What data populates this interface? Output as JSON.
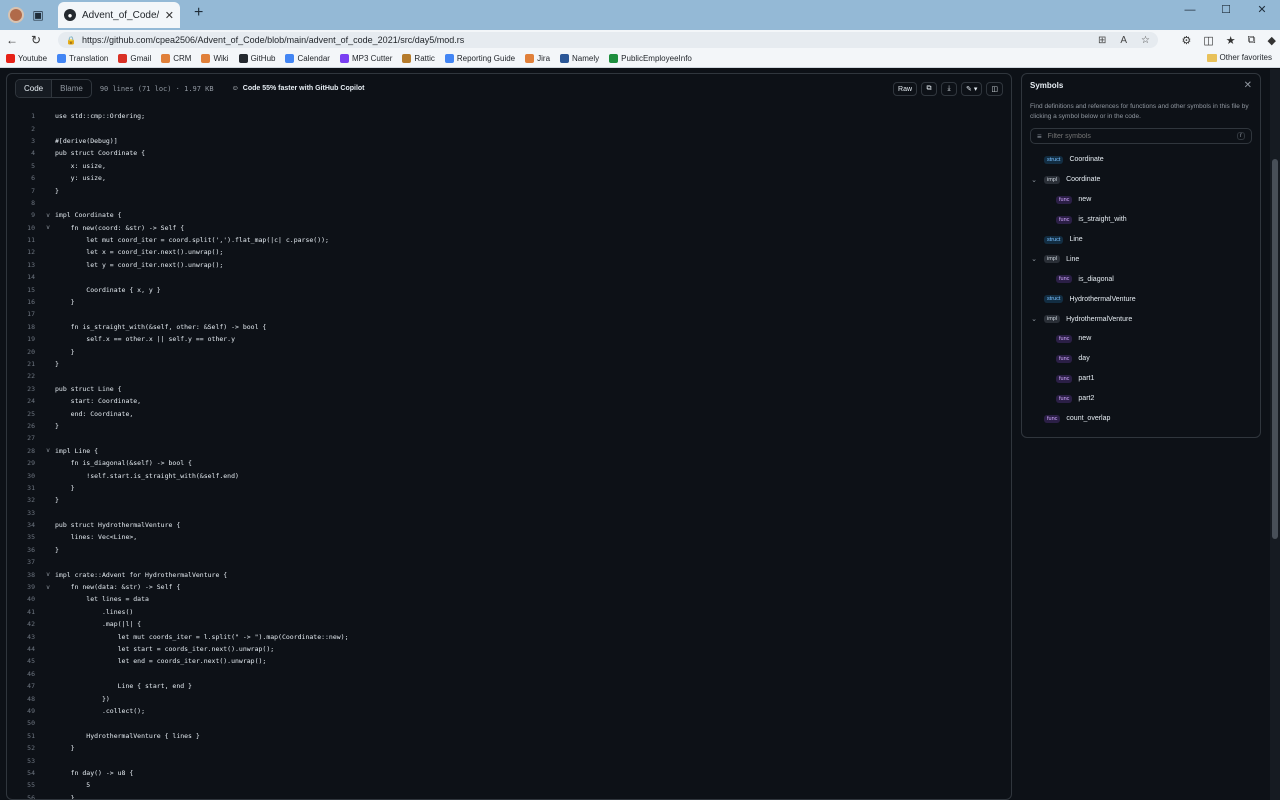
{
  "browser": {
    "tab_title": "Advent_of_Code/advent_of_code",
    "url": "https://github.com/cpea2506/Advent_of_Code/blob/main/advent_of_code_2021/src/day5/mod.rs",
    "bookmarks": [
      {
        "label": "Youtube",
        "color": "#e62117"
      },
      {
        "label": "Translation",
        "color": "#4285f4"
      },
      {
        "label": "Gmail",
        "color": "#d93025"
      },
      {
        "label": "CRM",
        "color": "#e0803a"
      },
      {
        "label": "Wiki",
        "color": "#e0803a"
      },
      {
        "label": "GitHub",
        "color": "#24292f"
      },
      {
        "label": "Calendar",
        "color": "#4285f4"
      },
      {
        "label": "MP3 Cutter",
        "color": "#7a3ff2"
      },
      {
        "label": "Rattic",
        "color": "#b57b2c"
      },
      {
        "label": "Reporting Guide",
        "color": "#4285f4"
      },
      {
        "label": "Jira",
        "color": "#e0803a"
      },
      {
        "label": "Namely",
        "color": "#2b5797"
      },
      {
        "label": "PublicEmployeeInfo",
        "color": "#1e8e3e"
      }
    ],
    "other_favorites": "Other favorites"
  },
  "code_header": {
    "code_tab": "Code",
    "blame_tab": "Blame",
    "file_info": "90 lines (71 loc) · 1.97 KB",
    "copilot": "Code 55% faster with GitHub Copilot",
    "raw": "Raw"
  },
  "code_lines": [
    {
      "n": "1",
      "fold": "",
      "text": "use std::cmp::Ordering;"
    },
    {
      "n": "2",
      "fold": "",
      "text": ""
    },
    {
      "n": "3",
      "fold": "",
      "text": "#[derive(Debug)]"
    },
    {
      "n": "4",
      "fold": "",
      "text": "pub struct Coordinate {"
    },
    {
      "n": "5",
      "fold": "",
      "text": "    x: usize,"
    },
    {
      "n": "6",
      "fold": "",
      "text": "    y: usize,"
    },
    {
      "n": "7",
      "fold": "",
      "text": "}"
    },
    {
      "n": "8",
      "fold": "",
      "text": ""
    },
    {
      "n": "9",
      "fold": "v",
      "text": "impl Coordinate {"
    },
    {
      "n": "10",
      "fold": "v",
      "text": "    fn new(coord: &str) -> Self {"
    },
    {
      "n": "11",
      "fold": "",
      "text": "        let mut coord_iter = coord.split(',').flat_map(|c| c.parse());"
    },
    {
      "n": "12",
      "fold": "",
      "text": "        let x = coord_iter.next().unwrap();"
    },
    {
      "n": "13",
      "fold": "",
      "text": "        let y = coord_iter.next().unwrap();"
    },
    {
      "n": "14",
      "fold": "",
      "text": ""
    },
    {
      "n": "15",
      "fold": "",
      "text": "        Coordinate { x, y }"
    },
    {
      "n": "16",
      "fold": "",
      "text": "    }"
    },
    {
      "n": "17",
      "fold": "",
      "text": ""
    },
    {
      "n": "18",
      "fold": "",
      "text": "    fn is_straight_with(&self, other: &Self) -> bool {"
    },
    {
      "n": "19",
      "fold": "",
      "text": "        self.x == other.x || self.y == other.y"
    },
    {
      "n": "20",
      "fold": "",
      "text": "    }"
    },
    {
      "n": "21",
      "fold": "",
      "text": "}"
    },
    {
      "n": "22",
      "fold": "",
      "text": ""
    },
    {
      "n": "23",
      "fold": "",
      "text": "pub struct Line {"
    },
    {
      "n": "24",
      "fold": "",
      "text": "    start: Coordinate,"
    },
    {
      "n": "25",
      "fold": "",
      "text": "    end: Coordinate,"
    },
    {
      "n": "26",
      "fold": "",
      "text": "}"
    },
    {
      "n": "27",
      "fold": "",
      "text": ""
    },
    {
      "n": "28",
      "fold": "v",
      "text": "impl Line {"
    },
    {
      "n": "29",
      "fold": "",
      "text": "    fn is_diagonal(&self) -> bool {"
    },
    {
      "n": "30",
      "fold": "",
      "text": "        !self.start.is_straight_with(&self.end)"
    },
    {
      "n": "31",
      "fold": "",
      "text": "    }"
    },
    {
      "n": "32",
      "fold": "",
      "text": "}"
    },
    {
      "n": "33",
      "fold": "",
      "text": ""
    },
    {
      "n": "34",
      "fold": "",
      "text": "pub struct HydrothermalVenture {"
    },
    {
      "n": "35",
      "fold": "",
      "text": "    lines: Vec<Line>,"
    },
    {
      "n": "36",
      "fold": "",
      "text": "}"
    },
    {
      "n": "37",
      "fold": "",
      "text": ""
    },
    {
      "n": "38",
      "fold": "v",
      "text": "impl crate::Advent for HydrothermalVenture {"
    },
    {
      "n": "39",
      "fold": "v",
      "text": "    fn new(data: &str) -> Self {"
    },
    {
      "n": "40",
      "fold": "",
      "text": "        let lines = data"
    },
    {
      "n": "41",
      "fold": "",
      "text": "            .lines()"
    },
    {
      "n": "42",
      "fold": "",
      "text": "            .map(|l| {"
    },
    {
      "n": "43",
      "fold": "",
      "text": "                let mut coords_iter = l.split(\" -> \").map(Coordinate::new);"
    },
    {
      "n": "44",
      "fold": "",
      "text": "                let start = coords_iter.next().unwrap();"
    },
    {
      "n": "45",
      "fold": "",
      "text": "                let end = coords_iter.next().unwrap();"
    },
    {
      "n": "46",
      "fold": "",
      "text": ""
    },
    {
      "n": "47",
      "fold": "",
      "text": "                Line { start, end }"
    },
    {
      "n": "48",
      "fold": "",
      "text": "            })"
    },
    {
      "n": "49",
      "fold": "",
      "text": "            .collect();"
    },
    {
      "n": "50",
      "fold": "",
      "text": ""
    },
    {
      "n": "51",
      "fold": "",
      "text": "        HydrothermalVenture { lines }"
    },
    {
      "n": "52",
      "fold": "",
      "text": "    }"
    },
    {
      "n": "53",
      "fold": "",
      "text": ""
    },
    {
      "n": "54",
      "fold": "",
      "text": "    fn day() -> u8 {"
    },
    {
      "n": "55",
      "fold": "",
      "text": "        5"
    },
    {
      "n": "56",
      "fold": "",
      "text": "    }"
    }
  ],
  "symbols": {
    "title": "Symbols",
    "description": "Find definitions and references for functions and other symbols in this file by clicking a symbol below or in the code.",
    "filter_placeholder": "Filter symbols",
    "filter_shortcut": "r",
    "items": [
      {
        "kind": "struct",
        "name": "Coordinate",
        "indent": 0,
        "expandable": false
      },
      {
        "kind": "impl",
        "name": "Coordinate",
        "indent": 0,
        "expandable": true
      },
      {
        "kind": "func",
        "name": "new",
        "indent": 1,
        "expandable": false
      },
      {
        "kind": "func",
        "name": "is_straight_with",
        "indent": 1,
        "expandable": false
      },
      {
        "kind": "struct",
        "name": "Line",
        "indent": 0,
        "expandable": false
      },
      {
        "kind": "impl",
        "name": "Line",
        "indent": 0,
        "expandable": true
      },
      {
        "kind": "func",
        "name": "is_diagonal",
        "indent": 1,
        "expandable": false
      },
      {
        "kind": "struct",
        "name": "HydrothermalVenture",
        "indent": 0,
        "expandable": false
      },
      {
        "kind": "impl",
        "name": "HydrothermalVenture",
        "indent": 0,
        "expandable": true
      },
      {
        "kind": "func",
        "name": "new",
        "indent": 1,
        "expandable": false
      },
      {
        "kind": "func",
        "name": "day",
        "indent": 1,
        "expandable": false
      },
      {
        "kind": "func",
        "name": "part1",
        "indent": 1,
        "expandable": false
      },
      {
        "kind": "func",
        "name": "part2",
        "indent": 1,
        "expandable": false
      },
      {
        "kind": "func",
        "name": "count_overlap",
        "indent": 0,
        "expandable": false
      }
    ]
  }
}
